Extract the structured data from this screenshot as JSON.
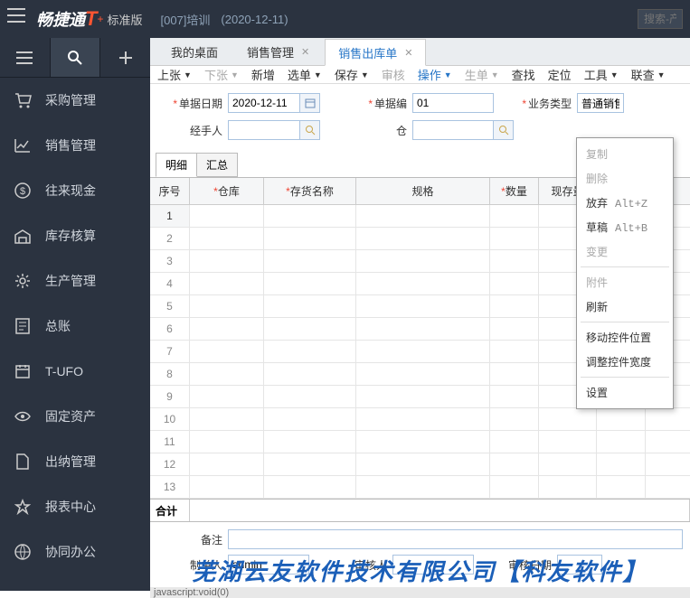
{
  "header": {
    "logo_text": "畅捷通",
    "logo_suffix": "T",
    "edition": "标准版",
    "org": "[007]培训",
    "date": "(2020-12-11)",
    "search_placeholder": "搜索-产"
  },
  "sidebar": {
    "items": [
      {
        "label": "采购管理"
      },
      {
        "label": "销售管理"
      },
      {
        "label": "往来现金"
      },
      {
        "label": "库存核算"
      },
      {
        "label": "生产管理"
      },
      {
        "label": "总账"
      },
      {
        "label": "T-UFO"
      },
      {
        "label": "固定资产"
      },
      {
        "label": "出纳管理"
      },
      {
        "label": "报表中心"
      },
      {
        "label": "协同办公"
      }
    ]
  },
  "tabs": [
    {
      "label": "我的桌面",
      "closable": false
    },
    {
      "label": "销售管理",
      "closable": true
    },
    {
      "label": "销售出库单",
      "closable": true,
      "active": true
    }
  ],
  "toolbar": {
    "prev": "上张",
    "next": "下张",
    "new": "新增",
    "select": "选单",
    "save": "保存",
    "audit": "审核",
    "operate": "操作",
    "make": "生单",
    "query": "查找",
    "locate": "定位",
    "tools": "工具",
    "link": "联查"
  },
  "form": {
    "doc_date_label": "单据日期",
    "doc_date_value": "2020-12-11",
    "doc_no_label": "单据编",
    "doc_no_value": "01",
    "biz_type_label": "业务类型",
    "biz_type_value": "普通销售",
    "handler_label": "经手人",
    "handler_value": "",
    "warehouse_short": "仓"
  },
  "sub_tabs": {
    "detail": "明细",
    "summary": "汇总"
  },
  "grid": {
    "columns": {
      "seq": "序号",
      "warehouse": "仓库",
      "inv_name": "存货名称",
      "spec": "规格",
      "qty": "数量",
      "stock": "现存量",
      "stock2": "现存量"
    },
    "row_count": 13,
    "sum_label": "合计"
  },
  "bottom": {
    "remark_label": "备注",
    "maker_label": "制单人",
    "maker_value": "admin",
    "approve_label": "审核人",
    "approve_date_label": "审核日期"
  },
  "dropdown": {
    "copy": "复制",
    "delete": "删除",
    "abandon": "放弃",
    "abandon_sc": "Alt+Z",
    "draft": "草稿",
    "draft_sc": "Alt+B",
    "change": "变更",
    "attach": "附件",
    "refresh": "刷新",
    "move_pos": "移动控件位置",
    "adjust_width": "调整控件宽度",
    "settings": "设置"
  },
  "watermark": "芜湖云友软件技术有限公司【科友软件】",
  "status": "javascript:void(0)"
}
